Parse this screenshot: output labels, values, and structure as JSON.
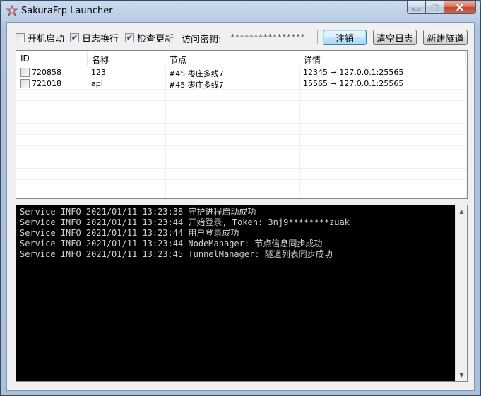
{
  "window": {
    "title": "SakuraFrp Launcher",
    "icon": "sakura-app-icon"
  },
  "toolbar": {
    "autostart_label": "开机启动",
    "autostart_checked": false,
    "logwrap_label": "日志换行",
    "logwrap_checked": true,
    "checkupdate_label": "检查更新",
    "checkupdate_checked": true,
    "key_label": "访问密钥:",
    "key_value": "****************",
    "logout_label": "注销",
    "clear_log_label": "清空日志",
    "new_tunnel_label": "新建隧道"
  },
  "tunnels": {
    "headers": [
      "ID",
      "名称",
      "节点",
      "详情"
    ],
    "rows": [
      {
        "id": "720858",
        "name": "123",
        "node": "#45 枣庄多线7",
        "detail": "12345 → 127.0.0.1:25565",
        "checked": false
      },
      {
        "id": "721018",
        "name": "api",
        "node": "#45 枣庄多线7",
        "detail": "15565 → 127.0.0.1:25565",
        "checked": false
      }
    ]
  },
  "log": {
    "lines": [
      "Service INFO 2021/01/11 13:23:38 守护进程启动成功",
      "Service INFO 2021/01/11 13:23:44 开始登录, Token: 3nj9********zuak",
      "Service INFO 2021/01/11 13:23:44 用户登录成功",
      "Service INFO 2021/01/11 13:23:44 NodeManager: 节点信息同步成功",
      "Service INFO 2021/01/11 13:23:45 TunnelManager: 隧道列表同步成功"
    ]
  },
  "colors": {
    "console_bg": "#000000",
    "console_fg": "#d0d0d0",
    "titlebar": "#b9cde4",
    "close_button": "#c2412a"
  }
}
